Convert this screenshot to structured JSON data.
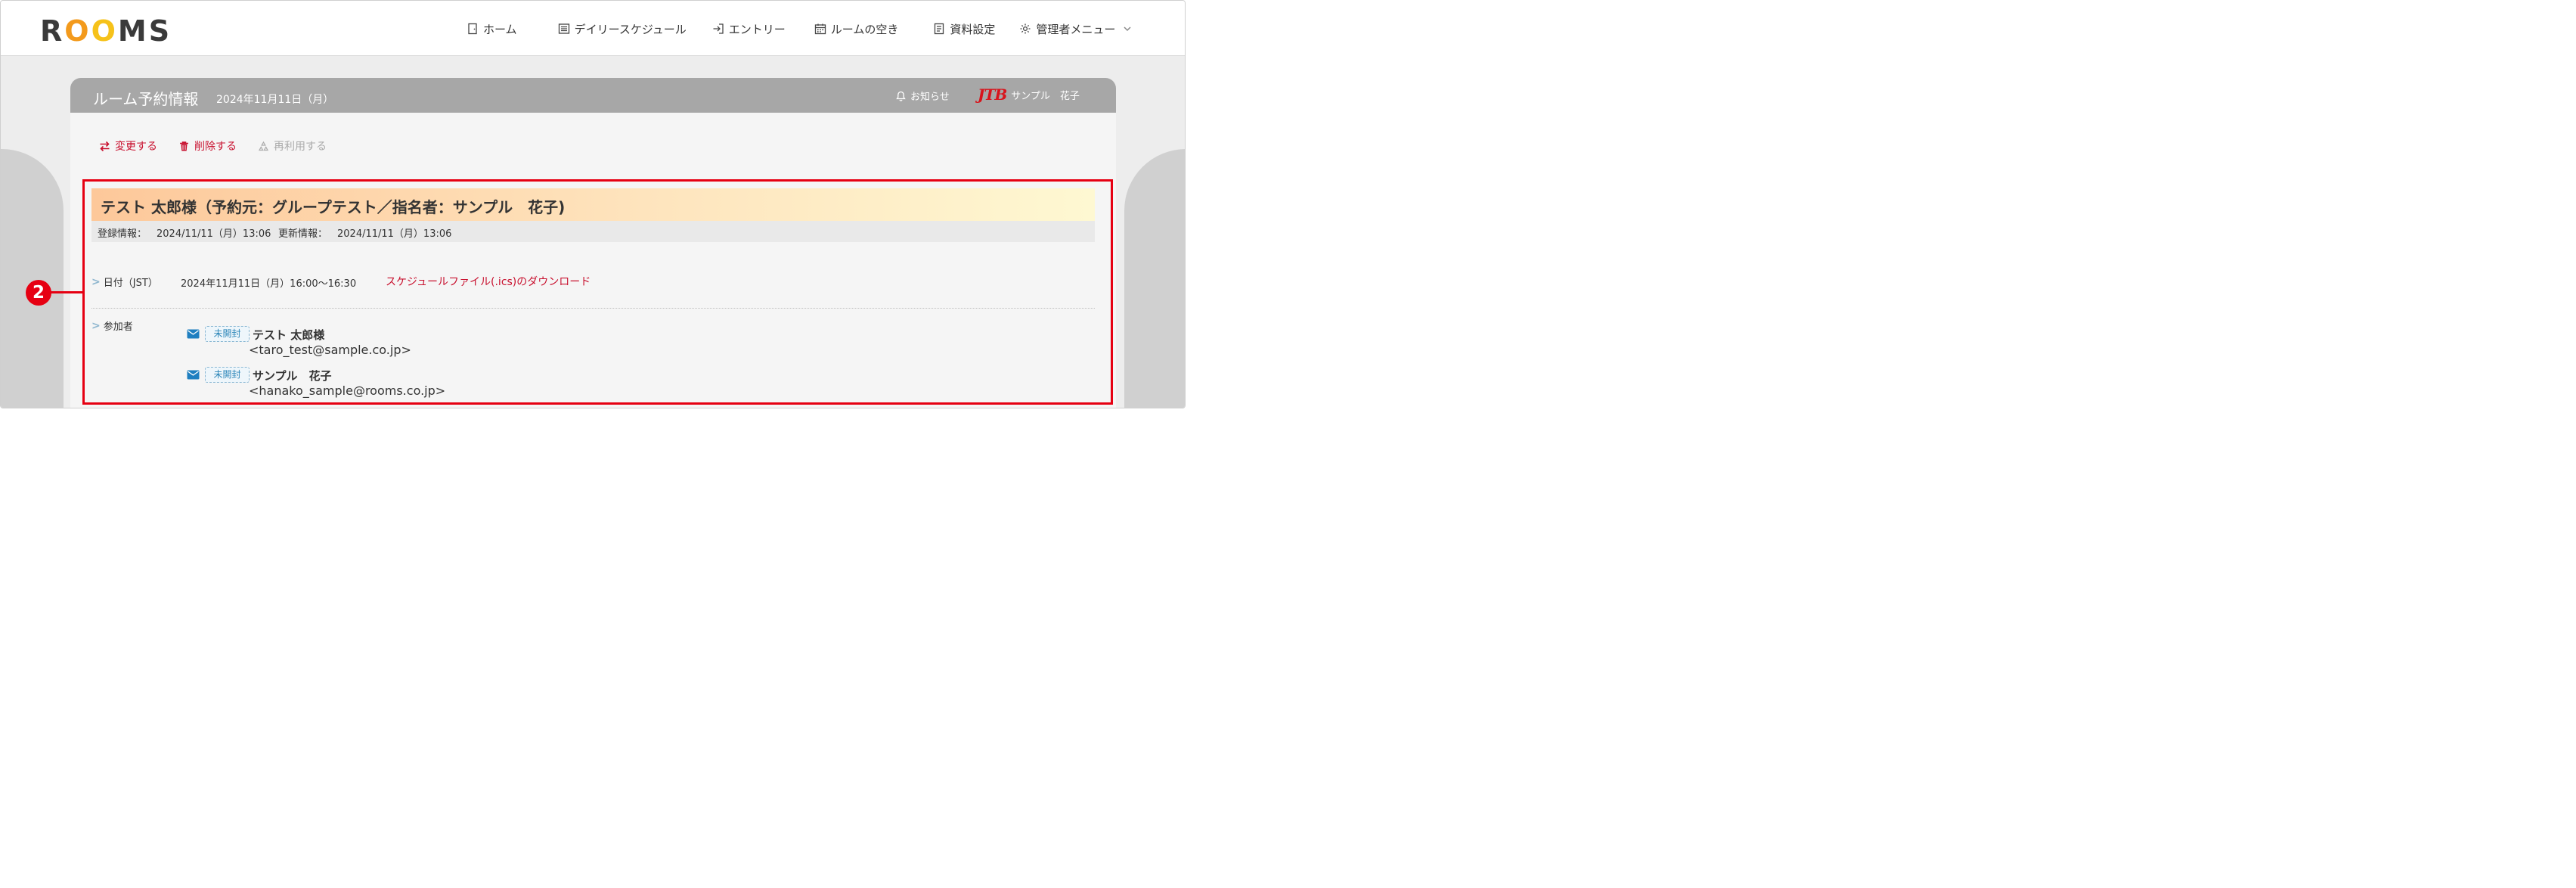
{
  "logo": {
    "letters": [
      "R",
      "O",
      "O",
      "M",
      "S"
    ]
  },
  "nav": [
    {
      "label": "ホーム",
      "icon": "door-icon"
    },
    {
      "label": "デイリースケジュール",
      "icon": "list-icon"
    },
    {
      "label": "エントリー",
      "icon": "sign-in-icon"
    },
    {
      "label": "ルームの空き",
      "icon": "calendar-icon"
    },
    {
      "label": "資料設定",
      "icon": "document-icon"
    },
    {
      "label": "管理者メニュー",
      "icon": "gear-icon"
    }
  ],
  "panel": {
    "title": "ルーム予約情報",
    "date": "2024年11月11日（月）",
    "notice": "お知らせ",
    "company_logo": "JTB",
    "user": "サンプル　花子"
  },
  "actions": {
    "change": "変更する",
    "delete": "削除する",
    "reuse": "再利用する"
  },
  "reservation": {
    "title": "テスト 太郎様（予約元：グループテスト／指名者：サンプル　花子)",
    "registered_label": "登録情報：",
    "registered_value": "2024/11/11（月）13:06",
    "updated_label": "更新情報：",
    "updated_value": "2024/11/11（月）13:06",
    "date_label": "日付（JST）",
    "date_value": "2024年11月11日（月）16:00〜16:30",
    "ics_link": "スケジュールファイル(.ics)のダウンロード",
    "participants_label": "参加者",
    "participants": [
      {
        "status": "未開封",
        "name": "テスト 太郎様",
        "email": "<taro_test@sample.co.jp>"
      },
      {
        "status": "未開封",
        "name": "サンプル　花子",
        "email": "<hanako_sample@rooms.co.jp>"
      }
    ]
  },
  "annotation": {
    "number": "2"
  },
  "colors": {
    "accent_red": "#c8102e",
    "header_gray": "#a7a7a7",
    "logo_orange": "#f39a1c",
    "logo_yellow": "#f6c21a",
    "annotation_red": "#e60012"
  }
}
